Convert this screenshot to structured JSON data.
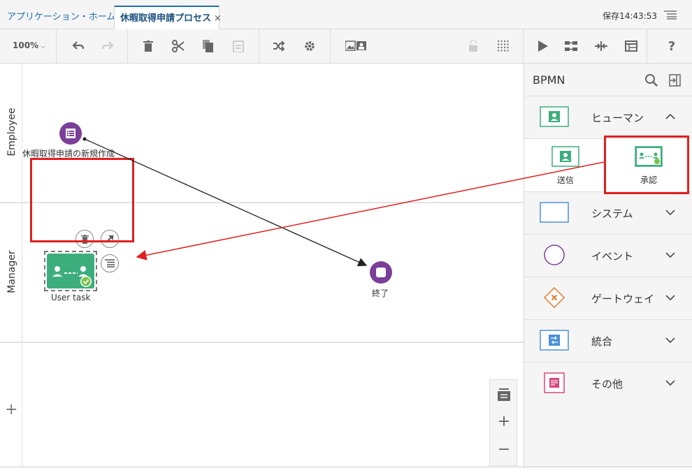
{
  "tabs": {
    "home_label": "アプリケーション・ホーム",
    "process_label": "休暇取得申請プロセス",
    "close_glyph": "×"
  },
  "save_status": "保存14:43:53",
  "toolbar": {
    "zoom_value": "100%",
    "icons": [
      "undo-icon",
      "redo-icon",
      "delete-icon",
      "cut-icon",
      "copy-icon",
      "paste-icon",
      "shuffle-icon",
      "settings-icon",
      "image-icon",
      "lock-icon",
      "grid-icon",
      "run-icon",
      "validate-icon",
      "merge-icon",
      "table-icon",
      "help-icon"
    ]
  },
  "canvas": {
    "lanes": [
      {
        "label": "Employee"
      },
      {
        "label": "Manager"
      }
    ],
    "add_lane_glyph": "+",
    "start_event_label": "休暇取得申請の新規作成",
    "user_task_label": "User task",
    "end_event_label": "終了",
    "zoom_panel": {
      "plus": "+",
      "minus": "−"
    }
  },
  "palette": {
    "title": "BPMN",
    "categories": [
      {
        "label": "ヒューマン",
        "expanded": true
      },
      {
        "label": "システム",
        "expanded": false
      },
      {
        "label": "イベント",
        "expanded": false
      },
      {
        "label": "ゲートウェイ",
        "expanded": false
      },
      {
        "label": "統合",
        "expanded": false
      },
      {
        "label": "その他",
        "expanded": false
      }
    ],
    "human_items": [
      {
        "label": "送信"
      },
      {
        "label": "承認"
      }
    ]
  },
  "colors": {
    "accent": "#1a6fb5",
    "event_purple": "#7b3f98",
    "task_green": "#3cae7d",
    "highlight_red": "#e02020",
    "system_blue": "#4a90d9",
    "gateway_orange": "#e8782a",
    "other_pink": "#d9467a"
  }
}
